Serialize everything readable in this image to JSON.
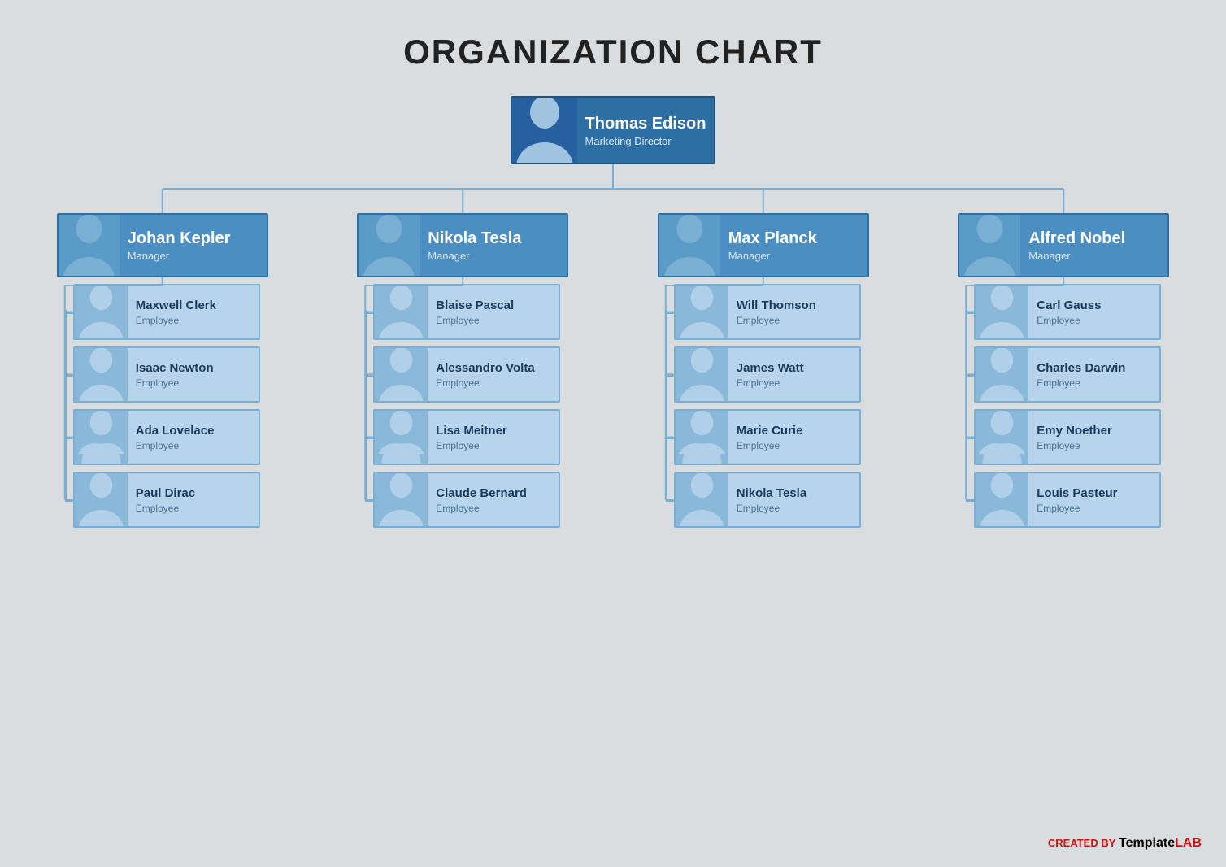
{
  "title": "ORGANIZATION CHART",
  "director": {
    "name": "Thomas Edison",
    "title": "Marketing Director",
    "type": "director"
  },
  "managers": [
    {
      "name": "Johan Kepler",
      "title": "Manager"
    },
    {
      "name": "Nikola Tesla",
      "title": "Manager"
    },
    {
      "name": "Max Planck",
      "title": "Manager"
    },
    {
      "name": "Alfred Nobel",
      "title": "Manager"
    }
  ],
  "employees": [
    [
      {
        "name": "Maxwell Clerk",
        "title": "Employee"
      },
      {
        "name": "Isaac Newton",
        "title": "Employee"
      },
      {
        "name": "Ada Lovelace",
        "title": "Employee"
      },
      {
        "name": "Paul Dirac",
        "title": "Employee"
      }
    ],
    [
      {
        "name": "Blaise Pascal",
        "title": "Employee"
      },
      {
        "name": "Alessandro Volta",
        "title": "Employee"
      },
      {
        "name": "Lisa Meitner",
        "title": "Employee"
      },
      {
        "name": "Claude Bernard",
        "title": "Employee"
      }
    ],
    [
      {
        "name": "Will Thomson",
        "title": "Employee"
      },
      {
        "name": "James Watt",
        "title": "Employee"
      },
      {
        "name": "Marie Curie",
        "title": "Employee"
      },
      {
        "name": "Nikola Tesla",
        "title": "Employee"
      }
    ],
    [
      {
        "name": "Carl Gauss",
        "title": "Employee"
      },
      {
        "name": "Charles Darwin",
        "title": "Employee"
      },
      {
        "name": "Emy Noether",
        "title": "Employee"
      },
      {
        "name": "Louis Pasteur",
        "title": "Employee"
      }
    ]
  ],
  "watermark": {
    "prefix": "CREATED BY",
    "template": "Template",
    "lab": "LAB"
  }
}
